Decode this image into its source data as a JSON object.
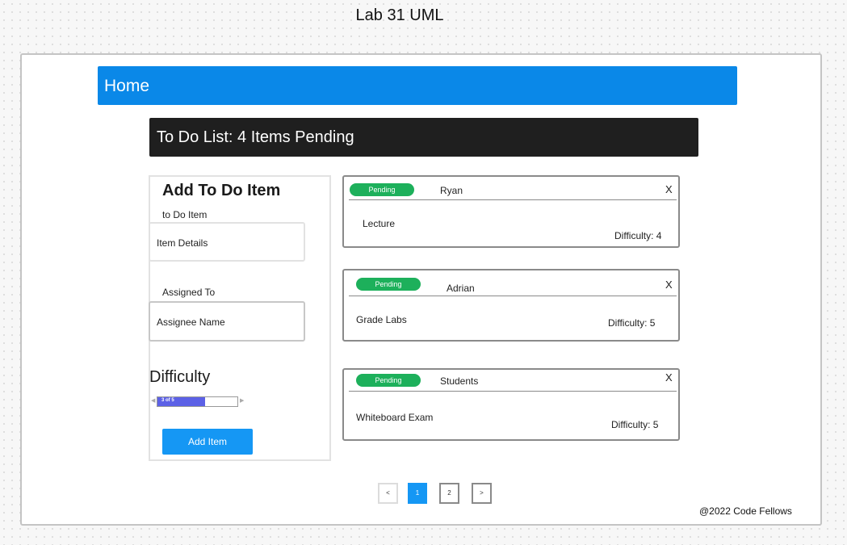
{
  "diagram_title": "Lab 31 UML",
  "header": {
    "home_label": "Home"
  },
  "list_header": {
    "title": "To Do List: 4 Items Pending"
  },
  "form": {
    "title": "Add To Do Item",
    "todo_label": "to Do Item",
    "details_placeholder": "Item Details",
    "assigned_label": "Assigned To",
    "assignee_placeholder": "Assignee Name",
    "difficulty_label": "Difficulty",
    "slider": {
      "value": 3,
      "max": 5,
      "text": "3 of 5",
      "left_arrow": "◀",
      "right_arrow": "▶"
    },
    "add_button_label": "Add Item"
  },
  "cards": [
    {
      "status": "Pending",
      "assignee": "Ryan",
      "close": "X",
      "task": "Lecture",
      "difficulty": "Difficulty: 4"
    },
    {
      "status": "Pending",
      "assignee": "Adrian",
      "close": "X",
      "task": "Grade Labs",
      "difficulty": "Difficulty: 5"
    },
    {
      "status": "Pending",
      "assignee": "Students",
      "close": "X",
      "task": "Whiteboard Exam",
      "difficulty": "Difficulty: 5"
    }
  ],
  "pagination": {
    "prev": "<",
    "pages": [
      "1",
      "2"
    ],
    "next": ">"
  },
  "footer": {
    "copyright": "@2022 Code Fellows"
  },
  "colors": {
    "home_bar": "#0a88e8",
    "list_header": "#1f1f1f",
    "pending_badge": "#1db05b",
    "primary_button": "#1597f4",
    "slider_fill": "#5c61e6"
  }
}
